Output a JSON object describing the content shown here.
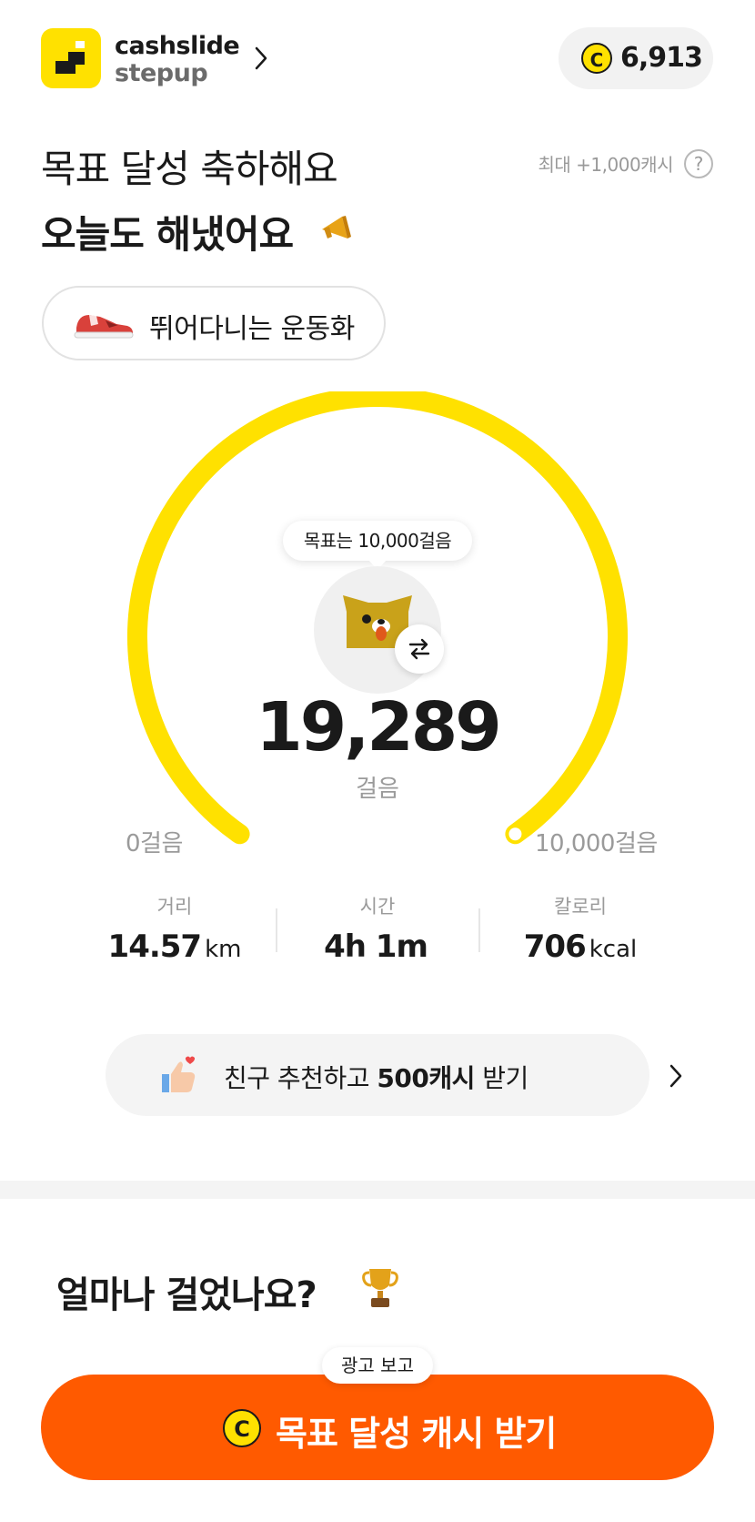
{
  "header": {
    "brand_line1": "cashslide",
    "brand_line2": "stepup",
    "points": "6,913",
    "coin_symbol": "C"
  },
  "hero": {
    "title_line1": "목표 달성 축하해요",
    "title_line2": "오늘도 해냈어요",
    "max_reward_note": "최대 +1,000캐시",
    "help_symbol": "?",
    "shoe_label": "뛰어다니는 운동화"
  },
  "gauge": {
    "goal_bubble": "목표는 10,000걸음",
    "steps": "19,289",
    "steps_unit": "걸음",
    "scale_min": "0걸음",
    "scale_max": "10,000걸음",
    "progress_fraction": 1.0,
    "arc_color": "#FFE100"
  },
  "stats": [
    {
      "label": "거리",
      "value": "14.57",
      "unit": "km"
    },
    {
      "label": "시간",
      "value": "4h 1m",
      "unit": ""
    },
    {
      "label": "칼로리",
      "value": "706",
      "unit": "kcal"
    }
  ],
  "friend_banner": {
    "prefix": "친구 추천하고 ",
    "bold": "500캐시",
    "suffix": " 받기"
  },
  "walk_section": {
    "title": "얼마나 걸었나요?"
  },
  "cta": {
    "ad_label": "광고 보고",
    "label": "목표 달성 캐시 받기",
    "coin_symbol": "C",
    "color": "#FF5A00"
  },
  "colors": {
    "brand_yellow": "#FFE100",
    "cta_orange": "#FF5A00"
  },
  "icons": [
    "logo-icon",
    "chevron-right-icon",
    "coin-icon",
    "megaphone-icon",
    "help-icon",
    "sneaker-icon",
    "character-icon",
    "swap-icon",
    "thumbs-up-icon",
    "trophy-icon"
  ]
}
